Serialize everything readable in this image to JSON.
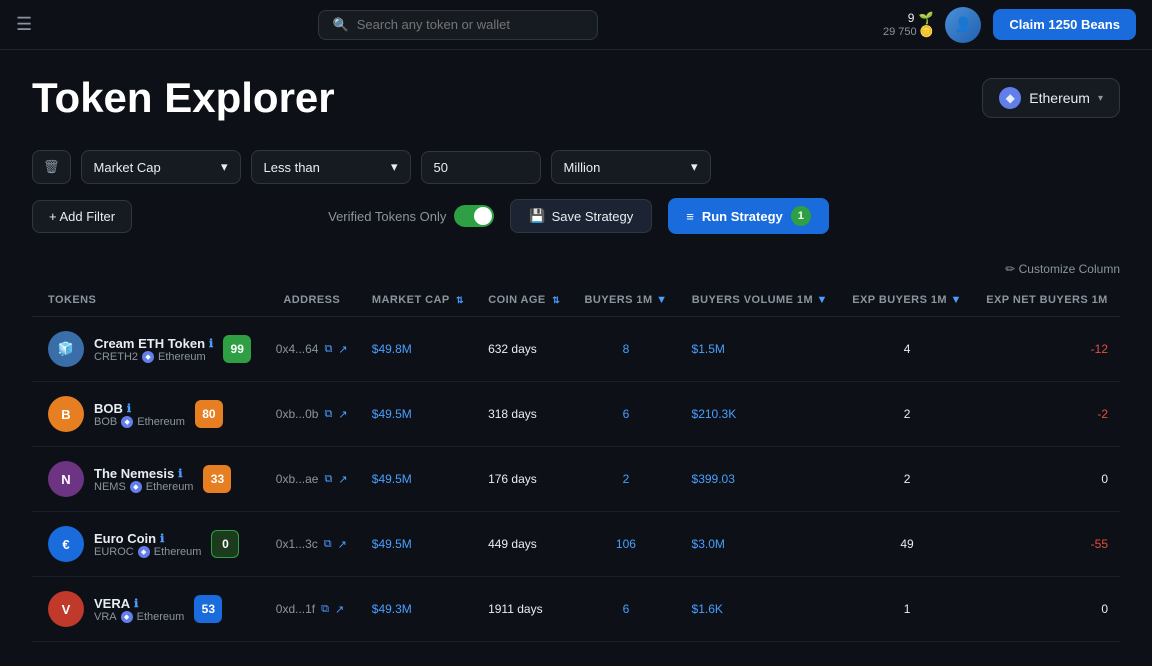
{
  "header": {
    "search_placeholder": "Search any token or wallet",
    "beans_count": "9",
    "beans_points": "29 750",
    "claim_button": "Claim 1250 Beans"
  },
  "page": {
    "title": "Token Explorer",
    "network": "Ethereum"
  },
  "filters": {
    "delete_label": "🗑",
    "market_cap_label": "Market Cap",
    "market_cap_chevron": "▾",
    "condition_label": "Less than",
    "condition_chevron": "▾",
    "value": "50",
    "unit_label": "Million",
    "unit_chevron": "▾",
    "add_filter": "+ Add Filter",
    "verified_label": "Verified Tokens Only",
    "save_label": "Save Strategy",
    "run_label": "Run Strategy",
    "run_count": "1"
  },
  "table": {
    "customize_col": "✏ Customize Column",
    "columns": [
      "TOKENS",
      "ADDRESS",
      "MARKET CAP",
      "COIN AGE",
      "BUYERS 1M ▼",
      "BUYERS VOLUME 1M ▼",
      "EXP BUYERS 1M ▼",
      "EXP NET BUYERS 1M"
    ],
    "rows": [
      {
        "name": "Cream ETH Token",
        "symbol": "CRETH2",
        "network": "Ethereum",
        "logo_color": "#3a6ea8",
        "logo_text": "🧊",
        "score": "99",
        "score_class": "score-green",
        "address": "0x4...64",
        "market_cap": "$49.8M",
        "coin_age": "632 days",
        "buyers": "8",
        "buyers_volume": "$1.5M",
        "exp_buyers": "4",
        "net_buyers": "-12",
        "net_buyers_class": "net-buyers-neg"
      },
      {
        "name": "BOB",
        "symbol": "BOB",
        "network": "Ethereum",
        "logo_color": "#e67e22",
        "logo_text": "B",
        "score": "80",
        "score_class": "score-orange",
        "address": "0xb...0b",
        "market_cap": "$49.5M",
        "coin_age": "318 days",
        "buyers": "6",
        "buyers_volume": "$210.3K",
        "exp_buyers": "2",
        "net_buyers": "-2",
        "net_buyers_class": "net-buyers-neg"
      },
      {
        "name": "The Nemesis",
        "symbol": "NEMS",
        "network": "Ethereum",
        "logo_color": "#9b59b6",
        "logo_text": "N",
        "score": "33",
        "score_class": "score-orange",
        "address": "0xb...ae",
        "market_cap": "$49.5M",
        "coin_age": "176 days",
        "buyers": "2",
        "buyers_volume": "$399.03",
        "exp_buyers": "2",
        "net_buyers": "0",
        "net_buyers_class": "net-buyers-zero"
      },
      {
        "name": "Euro Coin",
        "symbol": "EUROC",
        "network": "Ethereum",
        "logo_color": "#2980b9",
        "logo_text": "€",
        "score": "0",
        "score_class": "score-dark",
        "address": "0x1...3c",
        "market_cap": "$49.5M",
        "coin_age": "449 days",
        "buyers": "106",
        "buyers_volume": "$3.0M",
        "exp_buyers": "49",
        "net_buyers": "-55",
        "net_buyers_class": "net-buyers-neg"
      },
      {
        "name": "VERA",
        "symbol": "VRA",
        "network": "Ethereum",
        "logo_color": "#c0392b",
        "logo_text": "V",
        "score": "53",
        "score_class": "score-blue",
        "address": "0xd...1f",
        "market_cap": "$49.3M",
        "coin_age": "1911 days",
        "buyers": "6",
        "buyers_volume": "$1.6K",
        "exp_buyers": "1",
        "net_buyers": "0",
        "net_buyers_class": "net-buyers-zero"
      }
    ]
  }
}
